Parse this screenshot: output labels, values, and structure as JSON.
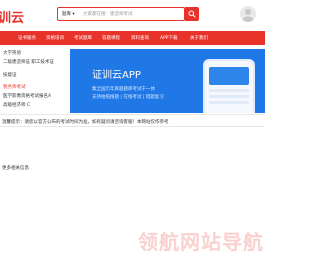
{
  "header": {
    "logo_text": "训云",
    "search": {
      "select_label": "题库 ▾",
      "placeholder": "大家都在搜：建造师考试"
    }
  },
  "nav": {
    "items": [
      "证书服务",
      "资格培训",
      "考试题库",
      "答题课程",
      "资料查询",
      "APP下载",
      "关于我们"
    ]
  },
  "sidebar": {
    "items": [
      {
        "label": "大学英语",
        "highlight": false
      },
      {
        "label": "二级建造师证    职工技术证",
        "highlight": false
      },
      {
        "label": "技能证",
        "highlight": false
      },
      {
        "label": "税务师考试",
        "highlight": true
      },
      {
        "label": "医学影像资格考试报名A",
        "highlight": false
      },
      {
        "label": "高级经济师 C",
        "highlight": false
      }
    ]
  },
  "banner": {
    "title": "证训云APP",
    "line1": "集全国历年真题题库考试于一体",
    "line2": "支持拍照搜题 | 在线考试 | 错题复习"
  },
  "content": {
    "line1": "温馨提示：请您以官方公布的考试时间为准，如有疑问请咨询客服！本网站仅作参考",
    "line2": "更多相关信息"
  },
  "watermark": "领航网站导航"
}
